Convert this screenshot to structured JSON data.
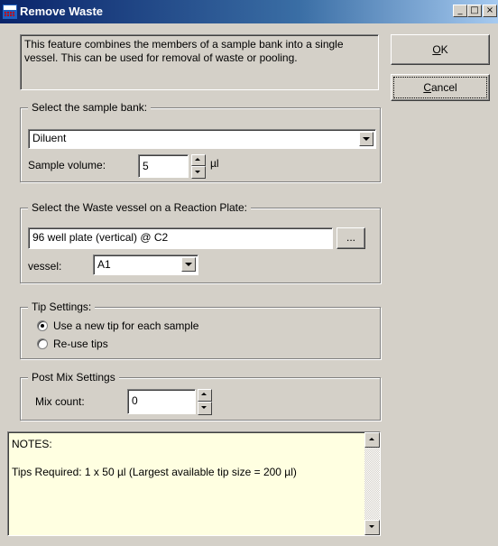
{
  "window": {
    "title": "Remove Waste",
    "minimize_glyph": "_",
    "maximize_glyph": "□",
    "close_glyph": "×"
  },
  "description": "This feature combines the members of a sample bank into a single vessel. This can be used for removal of waste or pooling.",
  "buttons": {
    "ok": "OK",
    "ok_hotkey": "O",
    "ok_rest": "K",
    "cancel_hotkey": "C",
    "cancel_rest": "ancel"
  },
  "sample_bank": {
    "legend": "Select the sample bank:",
    "selected": "Diluent",
    "volume_label": "Sample volume:",
    "volume_value": "5",
    "volume_unit": "µl"
  },
  "waste_vessel": {
    "legend": "Select the Waste vessel on a Reaction Plate:",
    "plate_value": "96 well plate (vertical) @ C2",
    "browse_label": "...",
    "vessel_label": "vessel:",
    "vessel_value": "A1"
  },
  "tip_settings": {
    "legend": "Tip Settings:",
    "options": [
      "Use a new tip for each sample",
      "Re-use tips"
    ],
    "selected_index": 0
  },
  "post_mix": {
    "legend": "Post Mix Settings",
    "count_label": "Mix count:",
    "count_value": "0"
  },
  "notes": {
    "heading": "NOTES:",
    "text": "Tips Required: 1 x 50 µl  (Largest available tip size = 200 µl)"
  }
}
